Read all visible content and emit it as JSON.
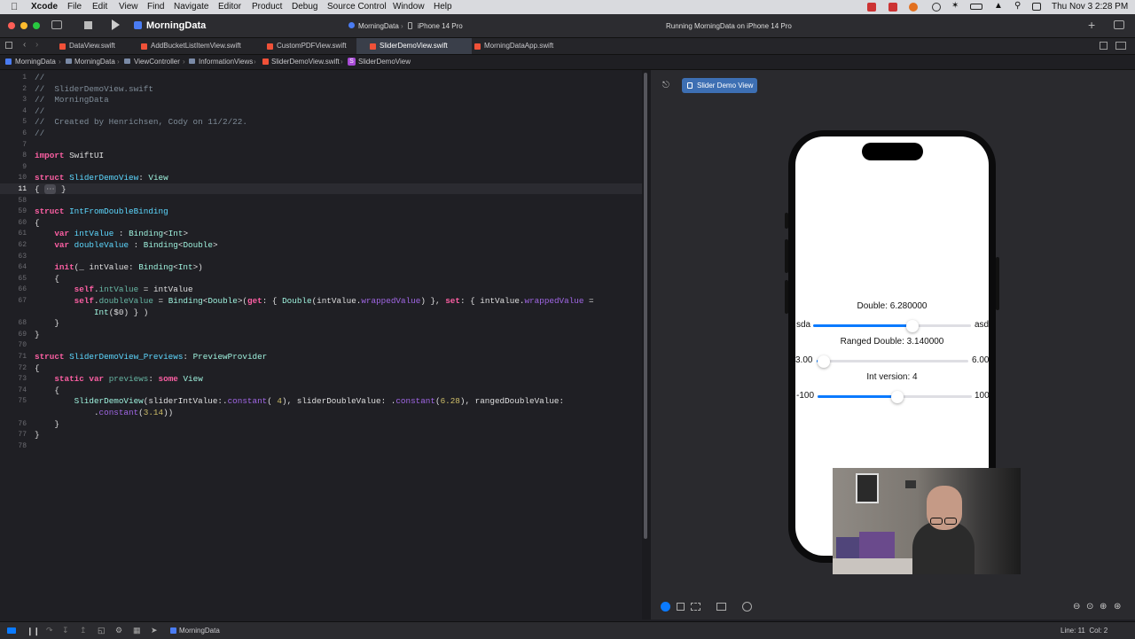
{
  "menubar": {
    "items": [
      "Xcode",
      "File",
      "Edit",
      "View",
      "Find",
      "Navigate",
      "Editor",
      "Product",
      "Debug",
      "Source Control",
      "Window",
      "Help"
    ],
    "clock": "Thu Nov 3  2:28 PM"
  },
  "toolbar": {
    "project": "MorningData",
    "scheme": "MorningData",
    "device": "iPhone 14 Pro",
    "status": "Running MorningData on iPhone 14 Pro"
  },
  "tabs": [
    "DataView.swift",
    "AddBucketListItemView.swift",
    "CustomPDFView.swift",
    "SliderDemoView.swift",
    "MorningDataApp.swift"
  ],
  "breadcrumb": [
    "MorningData",
    "MorningData",
    "ViewController",
    "InformationViews",
    "SliderDemoView.swift",
    "SliderDemoView"
  ],
  "editor": {
    "line_numbers": [
      "1",
      "2",
      "3",
      "4",
      "5",
      "6",
      "7",
      "8",
      "9",
      "10",
      "11",
      "58",
      "59",
      "60",
      "61",
      "62",
      "63",
      "64",
      "65",
      "66",
      "67",
      "",
      "68",
      "69",
      "70",
      "71",
      "72",
      "73",
      "74",
      "75",
      "",
      "76",
      "77",
      "78"
    ],
    "current_line": "11"
  },
  "canvas": {
    "pin_label": "Slider Demo View",
    "preview": {
      "double_label": "Double: 6.280000",
      "double_min": "sda",
      "double_max": "asd",
      "double_value": 0.628,
      "ranged_label": "Ranged Double: 3.140000",
      "ranged_min": "3.00",
      "ranged_max": "6.00",
      "ranged_value": 0.047,
      "int_label": "Int version: 4",
      "int_min": "-100",
      "int_max": "100",
      "int_value": 0.52
    }
  },
  "statusbar": {
    "target": "MorningData",
    "position": "Line: 11  Col: 2"
  },
  "colors": {
    "accent": "#0a7aff",
    "active_tab": "#3a3f4a",
    "keyword": "#fc5fa3",
    "type": "#5dd8ff"
  }
}
